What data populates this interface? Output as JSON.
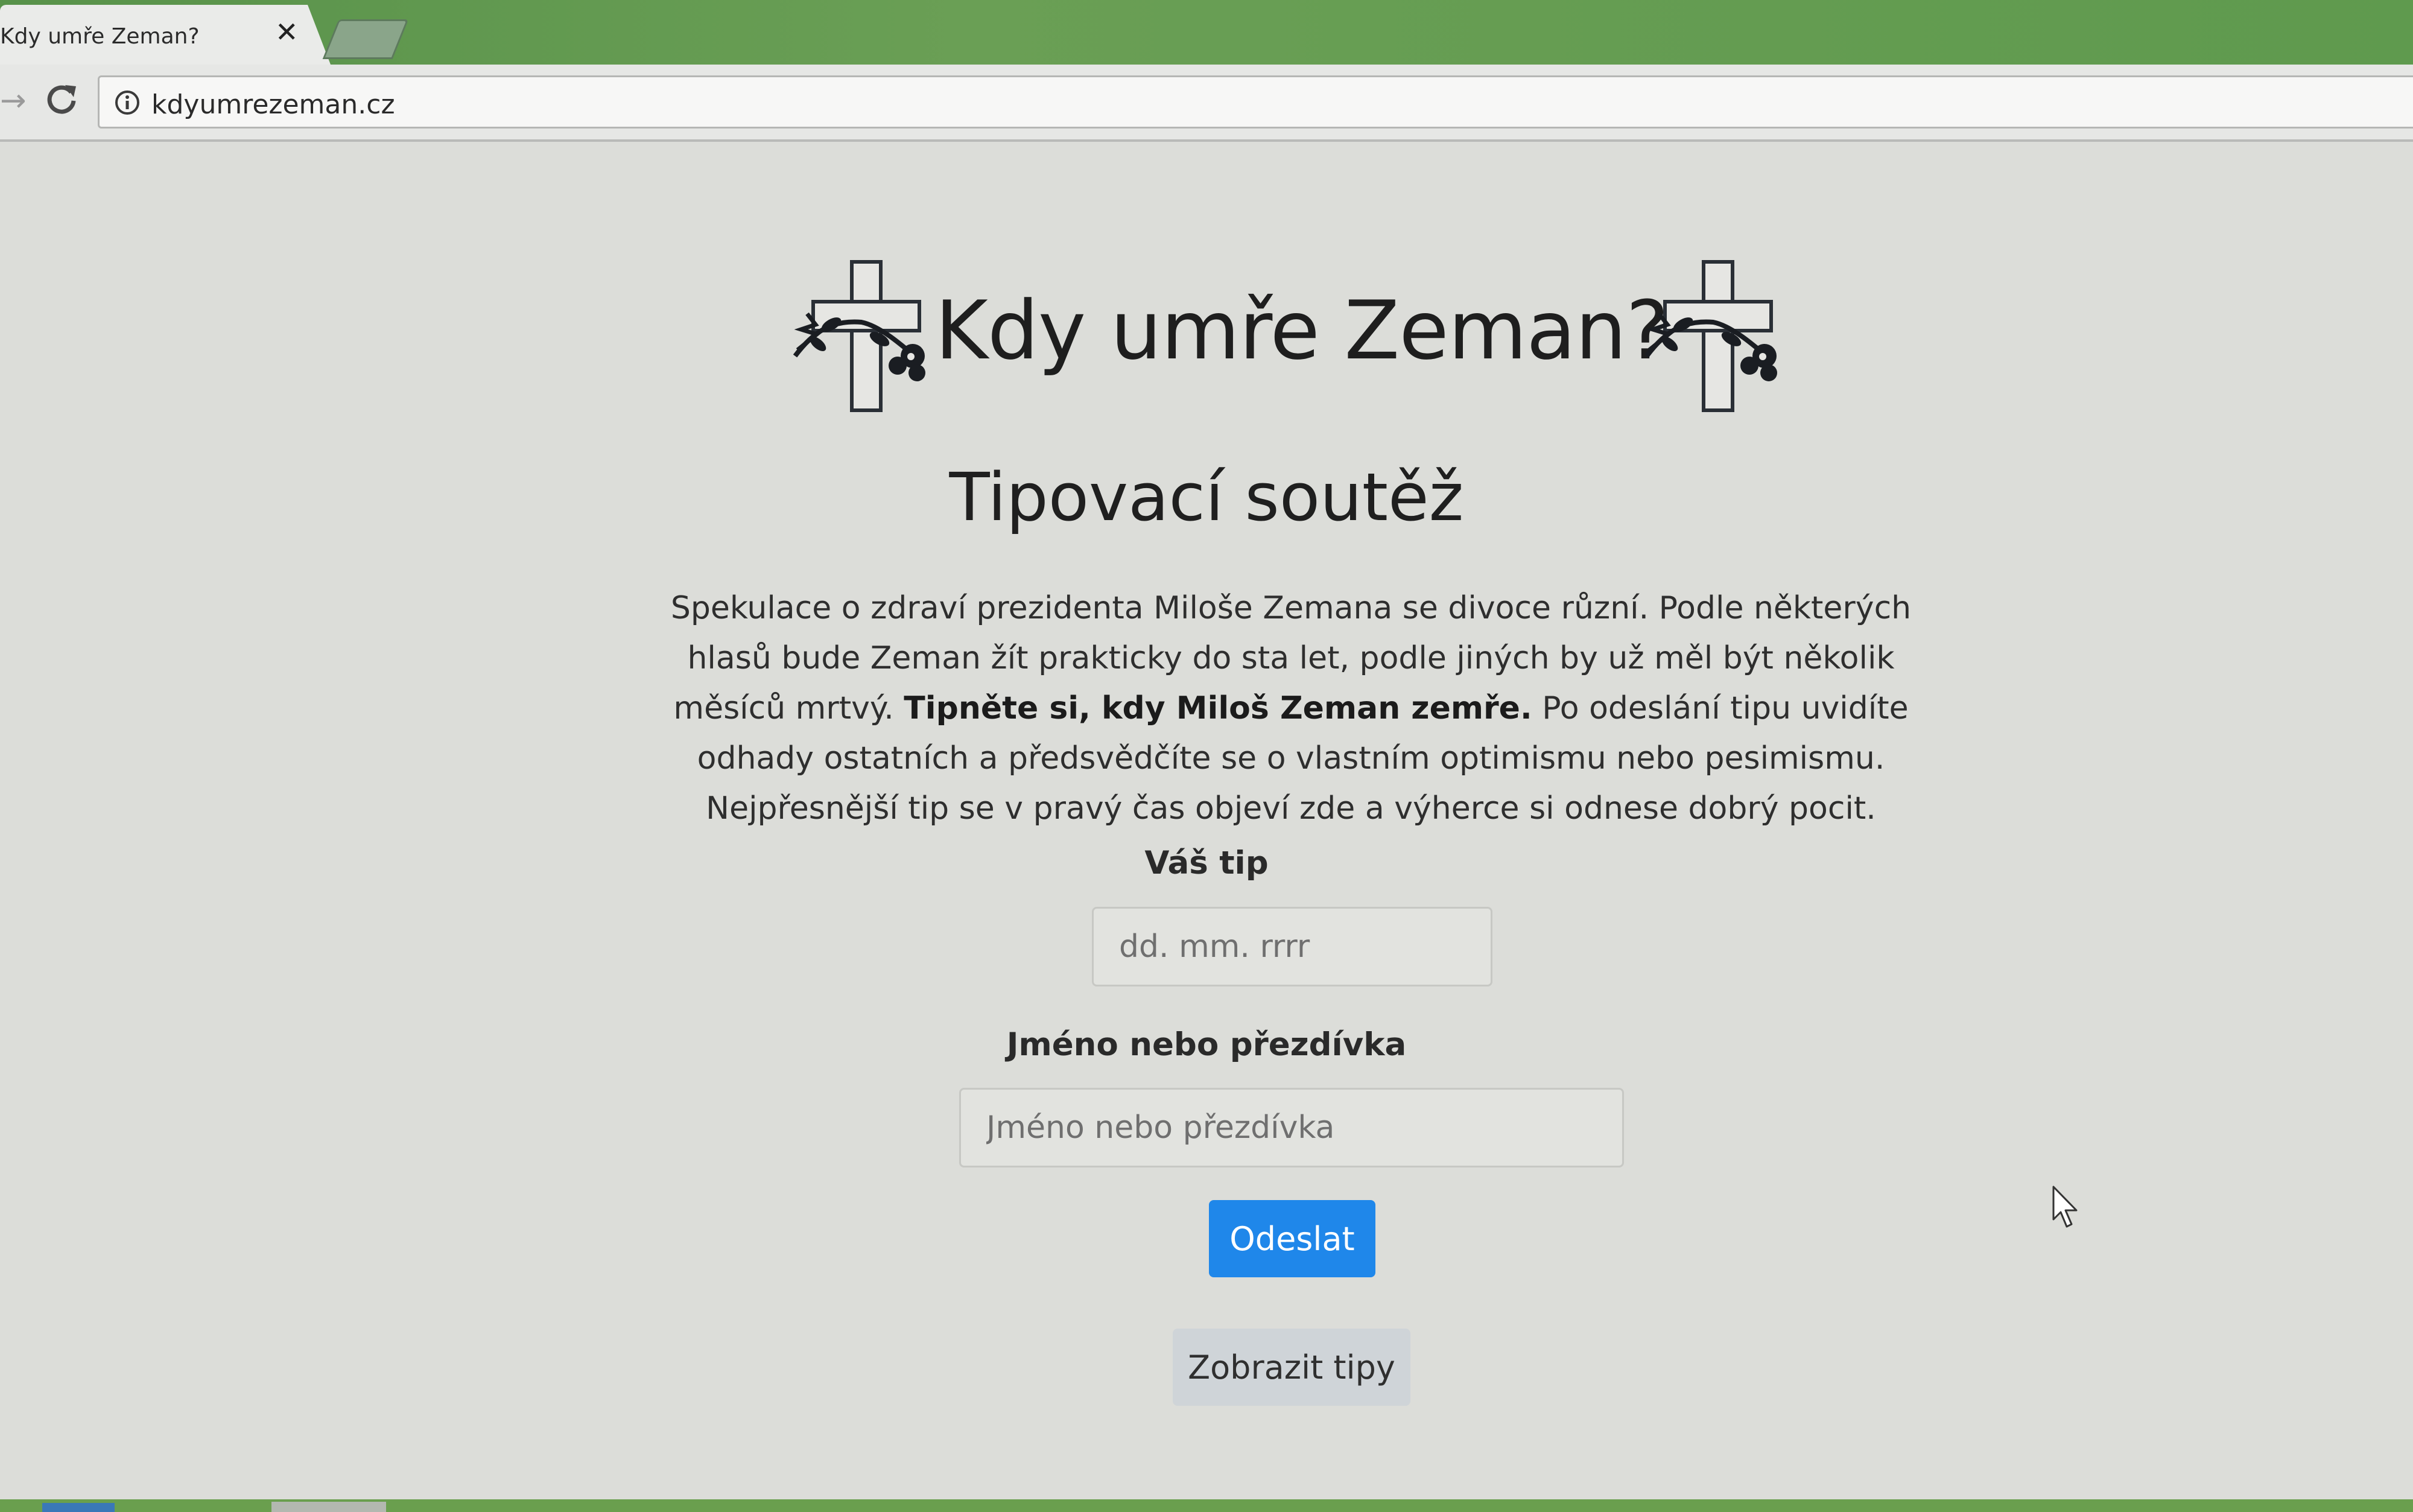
{
  "browser": {
    "tab_title": "Kdy umře Zeman?",
    "tab_close": "✕",
    "url": "kdyumrezeman.cz",
    "icons": {
      "forward": "arrow-right-icon",
      "reload": "reload-icon",
      "info": "info-icon"
    }
  },
  "page": {
    "title": "Kdy umře Zeman?",
    "subtitle": "Tipovací soutěž",
    "intro_part1": "Spekulace o zdraví prezidenta Miloše Zemana se divoce různí. Podle některých hlasů bude Zeman žít prakticky do sta let, podle jiných by už měl být několik měsíců mrtvý. ",
    "intro_bold": "Tipněte si, kdy Miloš Zeman zemře.",
    "intro_part2": " Po odeslání tipu uvidíte odhady ostatních a předsvědčíte se o vlastním optimismu nebo pesimismu. Nejpřesnější tip se v pravý čas objeví zde a výherce si odnese dobrý pocit.",
    "form": {
      "tip_label": "Váš tip",
      "tip_placeholder": "dd. mm. rrrr",
      "tip_value": "",
      "name_label": "Jméno nebo přezdívka",
      "name_placeholder": "Jméno nebo přezdívka",
      "name_value": "",
      "submit_label": "Odeslat",
      "show_tips_label": "Zobrazit tipy"
    },
    "decor_icons": [
      "cross-with-flowers-icon",
      "cross-with-flowers-icon"
    ]
  },
  "colors": {
    "accent": "#1f87ea",
    "page_background": "#dcddd9",
    "secondary_button": "#cfd4d8",
    "tabstrip": "#6a9f55"
  }
}
